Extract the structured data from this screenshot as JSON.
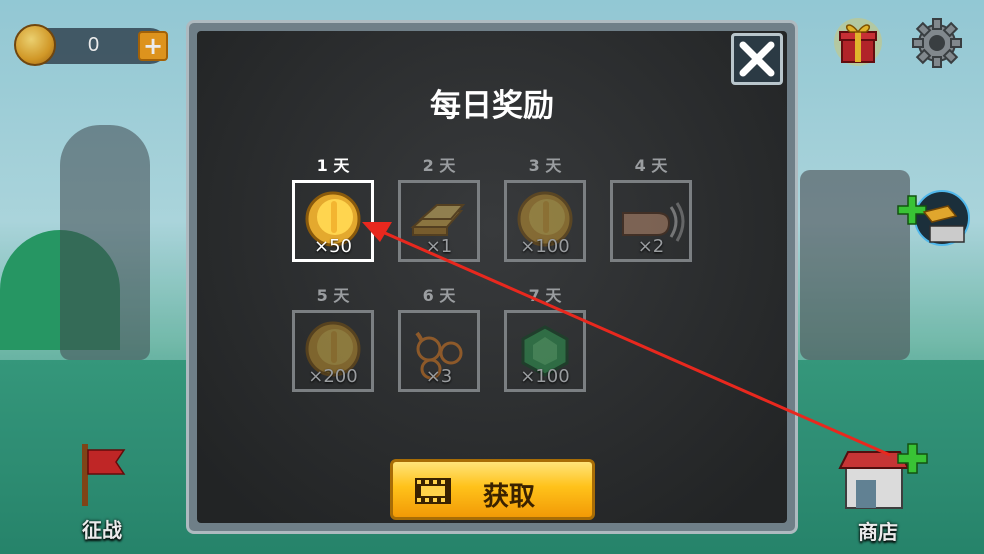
{
  "hud": {
    "coins": "0",
    "plus_label": "+"
  },
  "modal": {
    "title": "每日奖励",
    "get_button_label": "获取",
    "close_label": "✕",
    "days": [
      {
        "day": "1 天",
        "qty": "×50",
        "item": "coin-icon",
        "state": "active"
      },
      {
        "day": "2 天",
        "qty": "×1",
        "item": "gold-bar-icon",
        "state": "locked"
      },
      {
        "day": "3 天",
        "qty": "×100",
        "item": "coin-icon",
        "state": "locked"
      },
      {
        "day": "4 天",
        "qty": "×2",
        "item": "fist-icon",
        "state": "locked"
      },
      {
        "day": "5 天",
        "qty": "×200",
        "item": "coin-icon",
        "state": "locked"
      },
      {
        "day": "6 天",
        "qty": "×3",
        "item": "fire-rock-icon",
        "state": "locked"
      },
      {
        "day": "7 天",
        "qty": "×100",
        "item": "emerald-icon",
        "state": "locked"
      }
    ]
  },
  "nav": {
    "campaign": "征战",
    "shop": "商店"
  },
  "colors": {
    "active_border": "#ffffff",
    "button_gold": "#ffc21a",
    "arrow": "#e8281e"
  }
}
